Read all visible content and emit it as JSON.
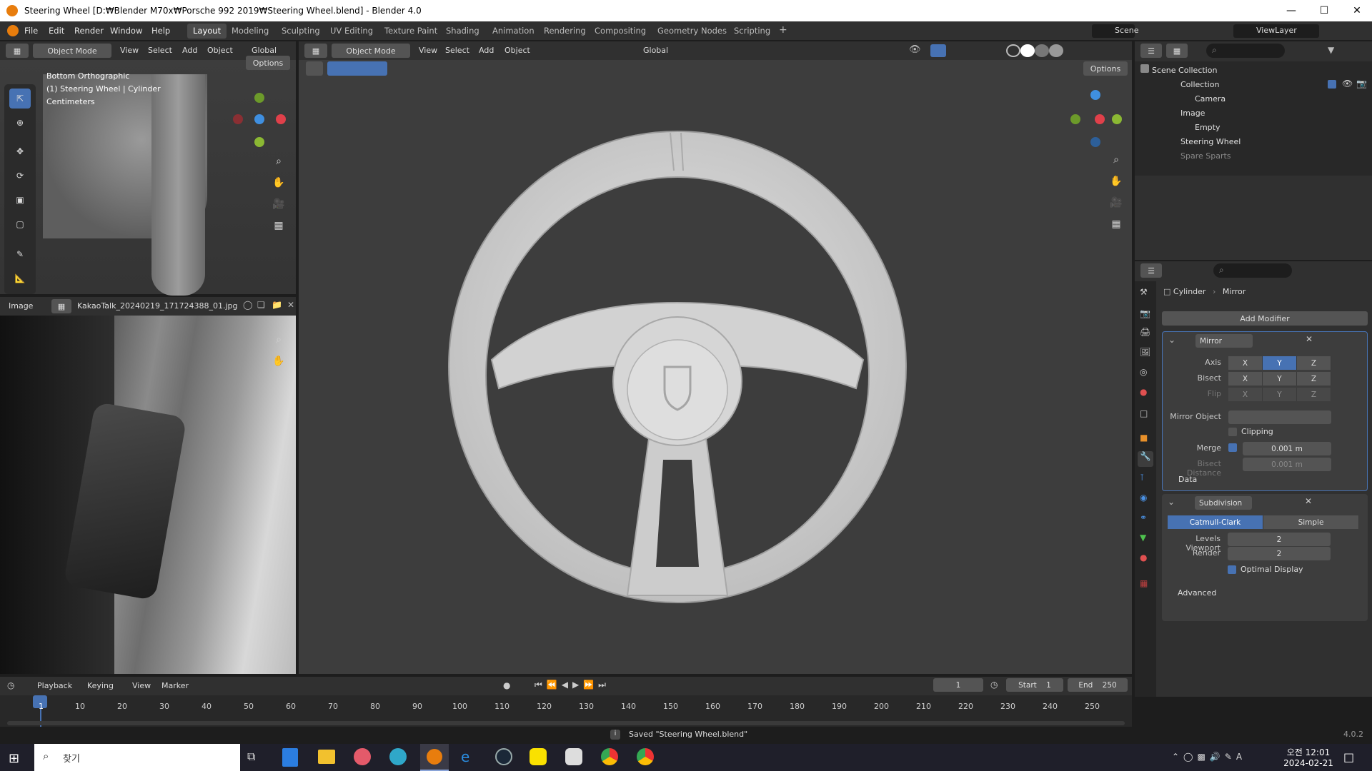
{
  "window": {
    "title": "Steering Wheel [D:₩Blender M70x₩Porsche 992 2019₩Steering Wheel.blend] - Blender 4.0"
  },
  "menu": {
    "items": [
      "File",
      "Edit",
      "Render",
      "Window",
      "Help"
    ]
  },
  "workspaces": [
    "Layout",
    "Modeling",
    "Sculpting",
    "UV Editing",
    "Texture Paint",
    "Shading",
    "Animation",
    "Rendering",
    "Compositing",
    "Geometry Nodes",
    "Scripting"
  ],
  "active_workspace": "Layout",
  "scene": {
    "name": "Scene",
    "view_layer": "ViewLayer"
  },
  "left_viewport": {
    "mode": "Object Mode",
    "menus": [
      "View",
      "Select",
      "Add",
      "Object"
    ],
    "orientation": "Global",
    "options": "Options",
    "overlay_title": "Bottom Orthographic",
    "overlay_object": "(1) Steering Wheel | Cylinder",
    "overlay_units": "Centimeters"
  },
  "image_editor": {
    "label": "Image",
    "filename": "KakaoTalk_20240219_171724388_01.jpg"
  },
  "main_viewport": {
    "mode": "Object Mode",
    "menus": [
      "View",
      "Select",
      "Add",
      "Object"
    ],
    "orientation": "Global",
    "options": "Options"
  },
  "outliner": {
    "items": [
      {
        "label": "Scene Collection",
        "indent": 0
      },
      {
        "label": "Collection",
        "indent": 1
      },
      {
        "label": "Camera",
        "indent": 2
      },
      {
        "label": "Image",
        "indent": 1
      },
      {
        "label": "Empty",
        "indent": 2
      },
      {
        "label": "Steering Wheel",
        "indent": 1
      },
      {
        "label": "Spare Sparts",
        "indent": 1
      }
    ]
  },
  "properties": {
    "breadcrumb_object": "Cylinder",
    "breadcrumb_modifier": "Mirror",
    "add_modifier": "Add Modifier",
    "mirror": {
      "name": "Mirror",
      "axis_label": "Axis",
      "bisect_label": "Bisect",
      "flip_label": "Flip",
      "x": "X",
      "y": "Y",
      "z": "Z",
      "mirror_object_label": "Mirror Object",
      "clipping_label": "Clipping",
      "merge_label": "Merge",
      "merge_value": "0.001 m",
      "bisect_distance_label": "Bisect Distance",
      "bisect_distance_value": "0.001 m",
      "data_label": "Data"
    },
    "subdivision": {
      "name": "Subdivision",
      "catmull": "Catmull-Clark",
      "simple": "Simple",
      "levels_viewport_label": "Levels Viewport",
      "levels_viewport": "2",
      "render_label": "Render",
      "render_value": "2",
      "optimal_label": "Optimal Display",
      "advanced_label": "Advanced"
    }
  },
  "timeline": {
    "menus": [
      "Playback",
      "Keying",
      "View",
      "Marker"
    ],
    "current_frame": "1",
    "start_label": "Start",
    "start": "1",
    "end_label": "End",
    "end": "250",
    "ticks": [
      "1",
      "10",
      "20",
      "30",
      "40",
      "50",
      "60",
      "70",
      "80",
      "90",
      "100",
      "110",
      "120",
      "130",
      "140",
      "150",
      "160",
      "170",
      "180",
      "190",
      "200",
      "210",
      "220",
      "230",
      "240",
      "250"
    ]
  },
  "status": {
    "message": "Saved \"Steering Wheel.blend\"",
    "version": "4.0.2"
  },
  "taskbar": {
    "search": "찾기",
    "time": "오전 12:01",
    "date": "2024-02-21"
  }
}
